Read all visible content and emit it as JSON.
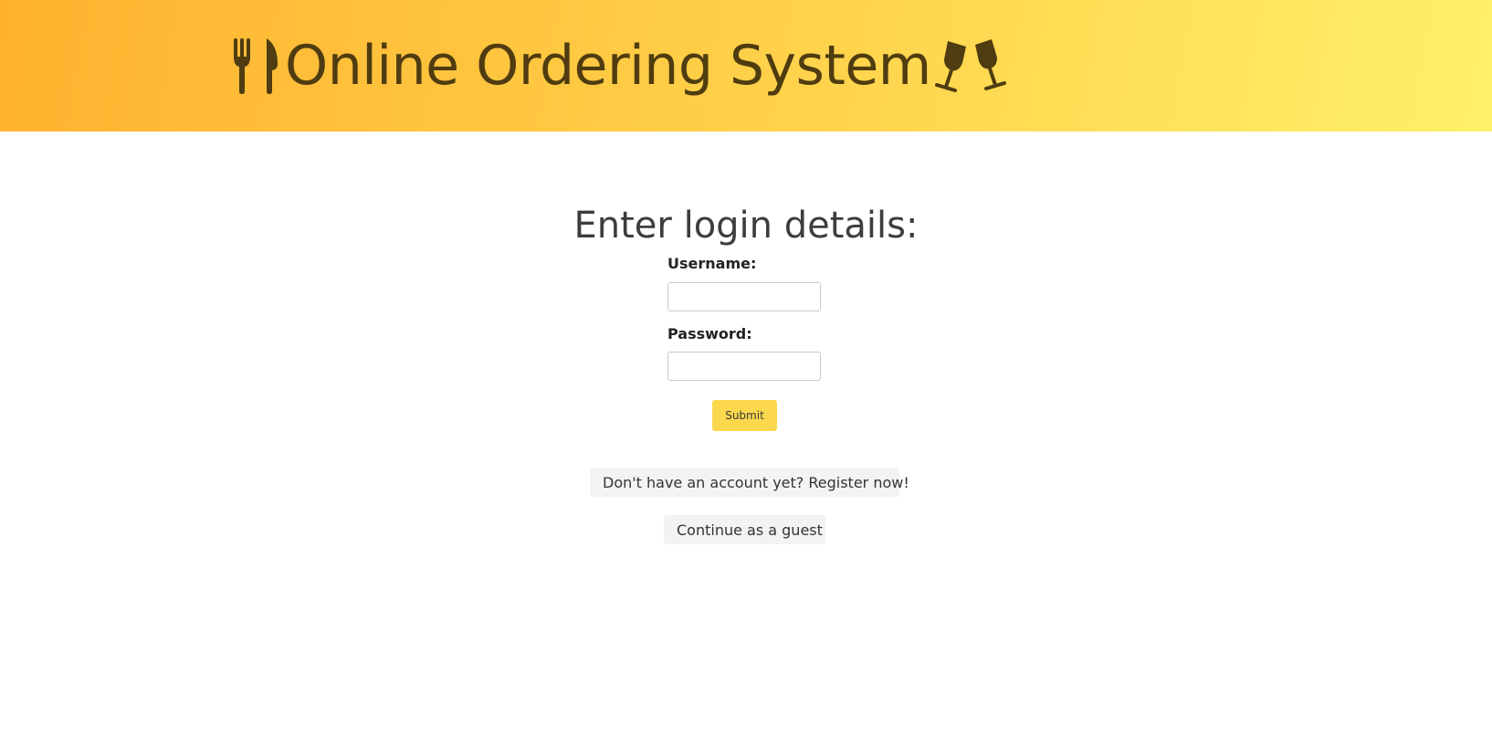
{
  "header": {
    "title": "Online Ordering System",
    "left_icon": "fork-knife-icon",
    "right_icon": "clinking-glasses-icon",
    "text_color": "#4f3c10"
  },
  "login": {
    "heading": "Enter login details:",
    "username_label": "Username:",
    "username_value": "",
    "password_label": "Password:",
    "password_value": "",
    "submit_label": "Submit",
    "register_label": "Don't have an account yet? Register now!",
    "guest_label": "Continue as a guest"
  },
  "colors": {
    "header_gradient_start": "#ffb22e",
    "header_gradient_end": "#fff06a",
    "submit_button": "#fcd84e",
    "secondary_button": "#f3f3f3"
  }
}
